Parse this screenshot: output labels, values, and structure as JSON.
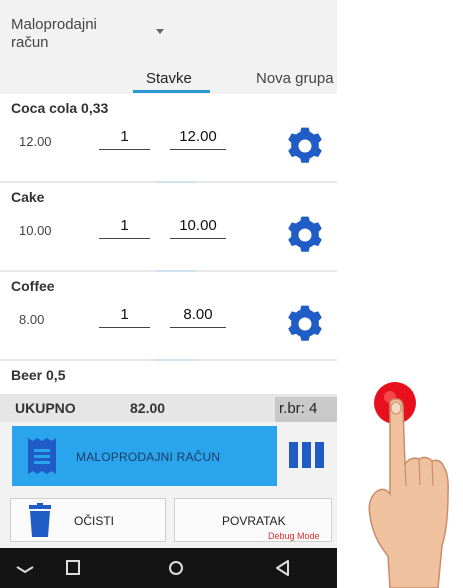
{
  "header": {
    "document_type": "Maloprodajni račun",
    "dropdown_icon": "caret-down-icon"
  },
  "tabs": [
    {
      "label": "Stavke",
      "active": true
    },
    {
      "label": "Nova grupa",
      "active": false
    }
  ],
  "items": [
    {
      "name": "Coca cola 0,33",
      "price": "12.00",
      "quantity": "1",
      "total": "12.00"
    },
    {
      "name": "Cake",
      "price": "10.00",
      "quantity": "1",
      "total": "10.00"
    },
    {
      "name": "Coffee",
      "price": "8.00",
      "quantity": "1",
      "total": "8.00"
    },
    {
      "name": "Beer 0,5",
      "price": "",
      "quantity": "",
      "total": ""
    }
  ],
  "summary": {
    "total_label": "UKUPNO",
    "total_value": "82.00",
    "receipt_number": "r.br: 4"
  },
  "actions": {
    "document_button_label": "MALOPRODAJNI RAČUN",
    "clear_label": "OČISTI",
    "back_label": "POVRATAK",
    "debug_label": "Debug Mode"
  },
  "colors": {
    "accent": "#2aa4ec",
    "gear": "#1f5cc6",
    "tab_underline": "#2a9ad6",
    "debug": "#e03131",
    "touch_indicator": "#e8101c"
  },
  "icons": {
    "item_settings": "gear-icon",
    "document": "receipt-icon",
    "menu": "vertical-bars-icon",
    "clear": "trash-icon",
    "nav_back": "nav-back-icon",
    "nav_home": "nav-home-icon",
    "nav_recent": "nav-recent-icon"
  }
}
